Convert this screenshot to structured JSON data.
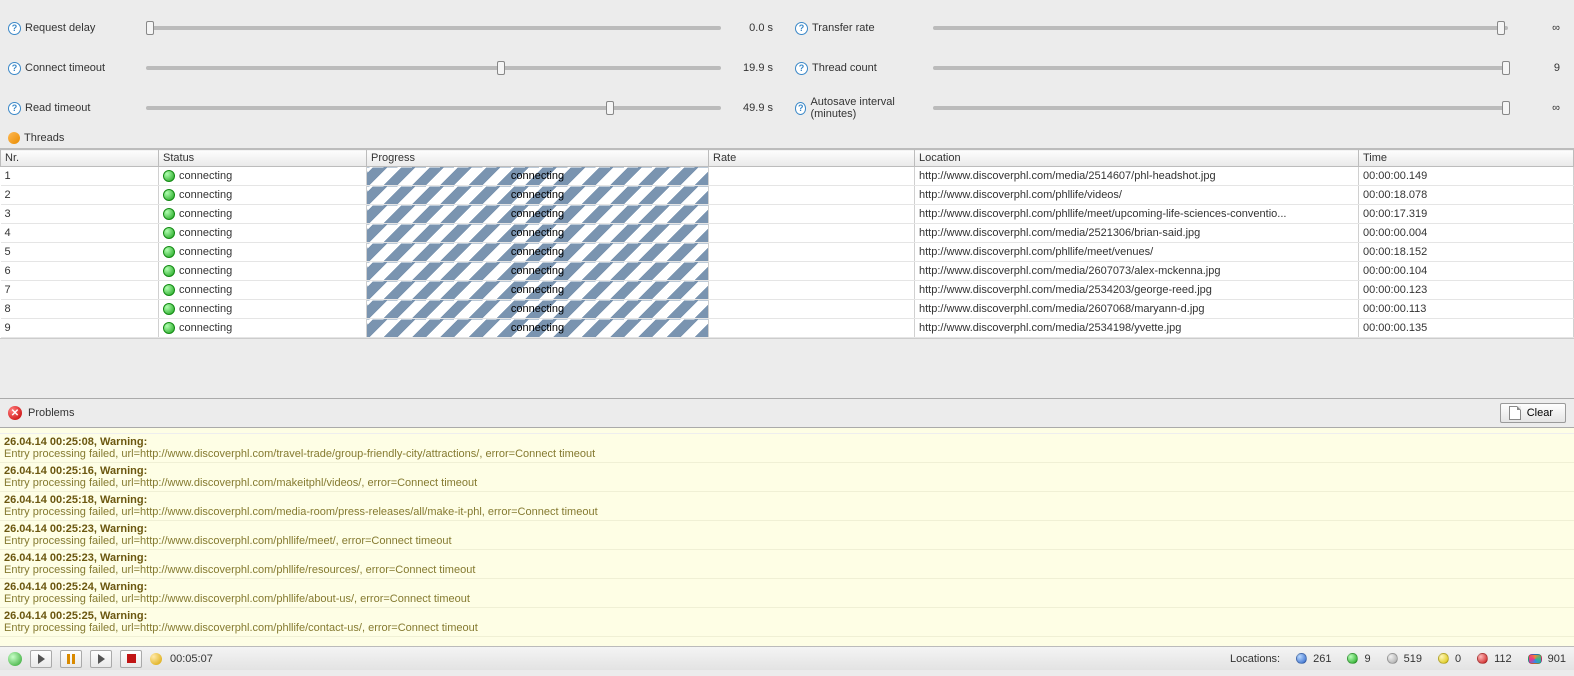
{
  "settings": {
    "left": [
      {
        "label": "Request delay",
        "value": "0.0 s",
        "thumb_pct": 0
      },
      {
        "label": "Connect timeout",
        "value": "19.9 s",
        "thumb_pct": 61
      },
      {
        "label": "Read timeout",
        "value": "49.9 s",
        "thumb_pct": 80
      }
    ],
    "right": [
      {
        "label": "Transfer rate",
        "value": "∞",
        "thumb_pct": 98
      },
      {
        "label": "Thread count",
        "value": "9",
        "thumb_pct": 99
      },
      {
        "label": "Autosave interval (minutes)",
        "value": "∞",
        "thumb_pct": 99
      }
    ]
  },
  "threads_section_label": "Threads",
  "threads_table": {
    "columns": [
      "Nr.",
      "Status",
      "Progress",
      "Rate",
      "Location",
      "Time"
    ],
    "rows": [
      {
        "nr": "1",
        "status": "connecting",
        "progress": "connecting",
        "rate": "",
        "location": "http://www.discoverphl.com/media/2514607/phl-headshot.jpg",
        "time": "00:00:00.149"
      },
      {
        "nr": "2",
        "status": "connecting",
        "progress": "connecting",
        "rate": "",
        "location": "http://www.discoverphl.com/phllife/videos/",
        "time": "00:00:18.078"
      },
      {
        "nr": "3",
        "status": "connecting",
        "progress": "connecting",
        "rate": "",
        "location": "http://www.discoverphl.com/phllife/meet/upcoming-life-sciences-conventio...",
        "time": "00:00:17.319"
      },
      {
        "nr": "4",
        "status": "connecting",
        "progress": "connecting",
        "rate": "",
        "location": "http://www.discoverphl.com/media/2521306/brian-said.jpg",
        "time": "00:00:00.004"
      },
      {
        "nr": "5",
        "status": "connecting",
        "progress": "connecting",
        "rate": "",
        "location": "http://www.discoverphl.com/phllife/meet/venues/",
        "time": "00:00:18.152"
      },
      {
        "nr": "6",
        "status": "connecting",
        "progress": "connecting",
        "rate": "",
        "location": "http://www.discoverphl.com/media/2607073/alex-mckenna.jpg",
        "time": "00:00:00.104"
      },
      {
        "nr": "7",
        "status": "connecting",
        "progress": "connecting",
        "rate": "",
        "location": "http://www.discoverphl.com/media/2534203/george-reed.jpg",
        "time": "00:00:00.123"
      },
      {
        "nr": "8",
        "status": "connecting",
        "progress": "connecting",
        "rate": "",
        "location": "http://www.discoverphl.com/media/2607068/maryann-d.jpg",
        "time": "00:00:00.113"
      },
      {
        "nr": "9",
        "status": "connecting",
        "progress": "connecting",
        "rate": "",
        "location": "http://www.discoverphl.com/media/2534198/yvette.jpg",
        "time": "00:00:00.135"
      }
    ]
  },
  "problems_section_label": "Problems",
  "clear_label": "Clear",
  "problems": [
    {
      "header": "26.04.14 00:25:08, Warning:",
      "body": "Entry processing failed, url=http://www.discoverphl.com/travel-trade/group-friendly-city/attractions/, error=Connect timeout"
    },
    {
      "header": "26.04.14 00:25:16, Warning:",
      "body": "Entry processing failed, url=http://www.discoverphl.com/makeitphl/videos/, error=Connect timeout"
    },
    {
      "header": "26.04.14 00:25:18, Warning:",
      "body": "Entry processing failed, url=http://www.discoverphl.com/media-room/press-releases/all/make-it-phl, error=Connect timeout"
    },
    {
      "header": "26.04.14 00:25:23, Warning:",
      "body": "Entry processing failed, url=http://www.discoverphl.com/phllife/meet/, error=Connect timeout"
    },
    {
      "header": "26.04.14 00:25:23, Warning:",
      "body": "Entry processing failed, url=http://www.discoverphl.com/phllife/resources/, error=Connect timeout"
    },
    {
      "header": "26.04.14 00:25:24, Warning:",
      "body": "Entry processing failed, url=http://www.discoverphl.com/phllife/about-us/, error=Connect timeout"
    },
    {
      "header": "26.04.14 00:25:25, Warning:",
      "body": "Entry processing failed, url=http://www.discoverphl.com/phllife/contact-us/, error=Connect timeout"
    }
  ],
  "statusbar": {
    "elapsed": "00:05:07",
    "locations_label": "Locations:",
    "counts": [
      {
        "color": "blue",
        "value": "261"
      },
      {
        "color": "green",
        "value": "9"
      },
      {
        "color": "grey",
        "value": "519"
      },
      {
        "color": "yellow",
        "value": "0"
      },
      {
        "color": "red",
        "value": "112"
      },
      {
        "color": "multi",
        "value": "901"
      }
    ]
  }
}
